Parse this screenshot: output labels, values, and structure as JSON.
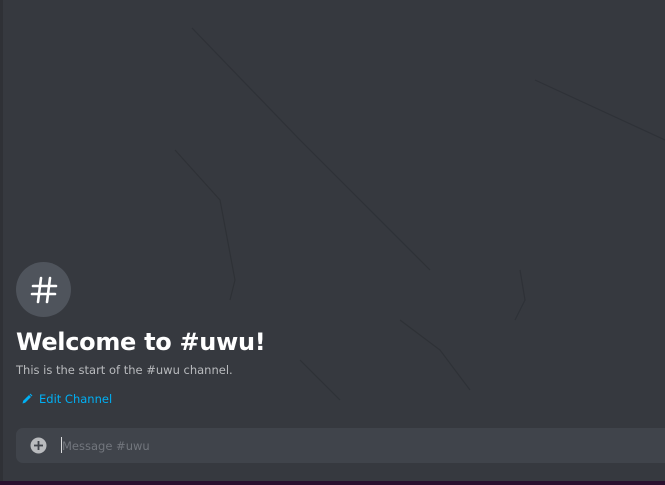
{
  "channel": {
    "icon": "hashtag-icon",
    "welcome_title": "Welcome to #uwu!",
    "welcome_subtitle": "This is the start of the #uwu channel.",
    "edit_label": "Edit Channel"
  },
  "composer": {
    "attach_icon": "plus-circle-icon",
    "placeholder": "Message #uwu",
    "value": ""
  },
  "colors": {
    "background": "#36393f",
    "accent_link": "#00b0f4",
    "composer": "#40444b"
  }
}
